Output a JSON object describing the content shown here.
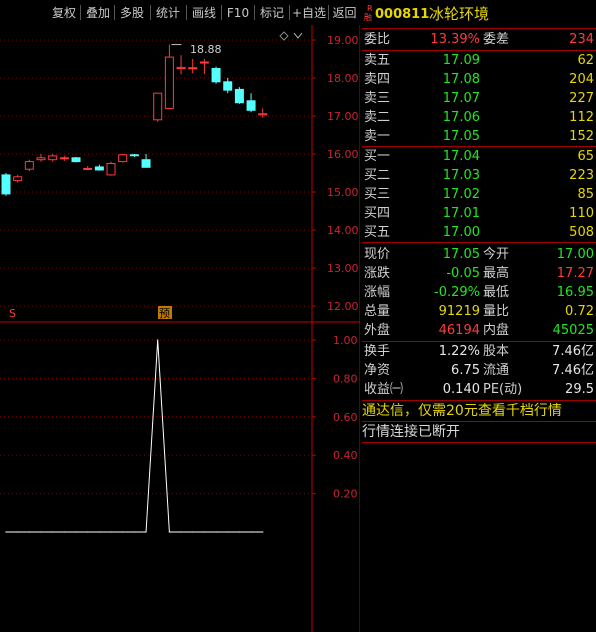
{
  "toolbar": {
    "buttons": [
      "复权",
      "叠加",
      "多股",
      "统计",
      "画线",
      "F10",
      "标记",
      "+自选",
      "返回"
    ]
  },
  "kline": {
    "peak_label": "18.88",
    "marker_s": "S",
    "marker_yu": "预"
  },
  "chart_data": [
    {
      "type": "candlestick",
      "y_ticks": [
        "19.00",
        "18.00",
        "17.00",
        "16.00",
        "15.00",
        "14.00",
        "13.00",
        "12.00"
      ],
      "ylim": [
        11.8,
        19.4
      ],
      "peak_annotation": "18.88",
      "candles": [
        {
          "o": 15.45,
          "h": 15.5,
          "l": 14.9,
          "c": 14.95
        },
        {
          "o": 15.3,
          "h": 15.45,
          "l": 15.25,
          "c": 15.4
        },
        {
          "o": 15.6,
          "h": 15.85,
          "l": 15.55,
          "c": 15.8
        },
        {
          "o": 15.85,
          "h": 16.0,
          "l": 15.8,
          "c": 15.9
        },
        {
          "o": 15.85,
          "h": 16.0,
          "l": 15.8,
          "c": 15.95
        },
        {
          "o": 15.88,
          "h": 15.95,
          "l": 15.82,
          "c": 15.9
        },
        {
          "o": 15.9,
          "h": 15.92,
          "l": 15.78,
          "c": 15.8
        },
        {
          "o": 15.6,
          "h": 15.68,
          "l": 15.58,
          "c": 15.62
        },
        {
          "o": 15.66,
          "h": 15.72,
          "l": 15.56,
          "c": 15.58
        },
        {
          "o": 15.45,
          "h": 15.8,
          "l": 15.43,
          "c": 15.75
        },
        {
          "o": 15.8,
          "h": 16.0,
          "l": 15.78,
          "c": 15.98
        },
        {
          "o": 15.98,
          "h": 16.0,
          "l": 15.92,
          "c": 15.96
        },
        {
          "o": 15.85,
          "h": 16.0,
          "l": 15.65,
          "c": 15.65
        },
        {
          "o": 16.9,
          "h": 17.6,
          "l": 16.85,
          "c": 17.6
        },
        {
          "o": 17.2,
          "h": 18.88,
          "l": 17.2,
          "c": 18.55
        },
        {
          "o": 18.25,
          "h": 18.6,
          "l": 18.1,
          "c": 18.28
        },
        {
          "o": 18.25,
          "h": 18.5,
          "l": 18.12,
          "c": 18.27
        },
        {
          "o": 18.4,
          "h": 18.5,
          "l": 18.1,
          "c": 18.42
        },
        {
          "o": 18.25,
          "h": 18.3,
          "l": 17.85,
          "c": 17.9
        },
        {
          "o": 17.9,
          "h": 18.0,
          "l": 17.6,
          "c": 17.68
        },
        {
          "o": 17.7,
          "h": 17.76,
          "l": 17.32,
          "c": 17.35
        },
        {
          "o": 17.4,
          "h": 17.6,
          "l": 17.1,
          "c": 17.15
        },
        {
          "o": 17.03,
          "h": 17.2,
          "l": 16.95,
          "c": 17.06
        }
      ]
    },
    {
      "type": "line",
      "y_ticks": [
        "1.00",
        "0.80",
        "0.60",
        "0.40",
        "0.20"
      ],
      "ylim": [
        -0.16,
        1.04
      ],
      "values": [
        0,
        0,
        0,
        0,
        0,
        0,
        0,
        0,
        0,
        0,
        0,
        0,
        0,
        1.0,
        0,
        0,
        0,
        0,
        0,
        0,
        0,
        0,
        0
      ]
    }
  ],
  "quote": {
    "code": "000811",
    "name": "冰轮环境",
    "r_badge_top": "R",
    "r_badge_bottom": "融",
    "weibi_label": "委比",
    "weibi": "13.39%",
    "weicha_label": "委差",
    "weicha": "234",
    "sell": [
      {
        "label": "卖五",
        "price": "17.09",
        "vol": "62"
      },
      {
        "label": "卖四",
        "price": "17.08",
        "vol": "204"
      },
      {
        "label": "卖三",
        "price": "17.07",
        "vol": "227"
      },
      {
        "label": "卖二",
        "price": "17.06",
        "vol": "112"
      },
      {
        "label": "卖一",
        "price": "17.05",
        "vol": "152"
      }
    ],
    "buy": [
      {
        "label": "买一",
        "price": "17.04",
        "vol": "65"
      },
      {
        "label": "买二",
        "price": "17.03",
        "vol": "223"
      },
      {
        "label": "买三",
        "price": "17.02",
        "vol": "85"
      },
      {
        "label": "买四",
        "price": "17.01",
        "vol": "110"
      },
      {
        "label": "买五",
        "price": "17.00",
        "vol": "508"
      }
    ],
    "stats": [
      {
        "l1": "现价",
        "v1": "17.05",
        "c1": "green",
        "l2": "今开",
        "v2": "17.00",
        "c2": "green"
      },
      {
        "l1": "涨跌",
        "v1": "-0.05",
        "c1": "green",
        "l2": "最高",
        "v2": "17.27",
        "c2": "red"
      },
      {
        "l1": "涨幅",
        "v1": "-0.29%",
        "c1": "green",
        "l2": "最低",
        "v2": "16.95",
        "c2": "green"
      },
      {
        "l1": "总量",
        "v1": "91219",
        "c1": "yellow",
        "l2": "量比",
        "v2": "0.72",
        "c2": "yellow"
      },
      {
        "l1": "外盘",
        "v1": "46194",
        "c1": "red",
        "l2": "内盘",
        "v2": "45025",
        "c2": "green"
      }
    ],
    "finance": [
      {
        "l1": "换手",
        "v1": "1.22%",
        "l2": "股本",
        "v2": "7.46亿"
      },
      {
        "l1": "净资",
        "v1": "6.75",
        "l2": "流通",
        "v2": "7.46亿"
      },
      {
        "l1": "收益㈠",
        "v1": "0.140",
        "l2": "PE(动)",
        "v2": "29.5"
      }
    ],
    "ad_text": "通达信，仅需20元查看千档行情",
    "status_text": "行情连接已断开"
  },
  "colors": {
    "up": "#ff3b3b",
    "down": "#54ffff",
    "grid": "#8b0000",
    "axis": "#c00000"
  }
}
